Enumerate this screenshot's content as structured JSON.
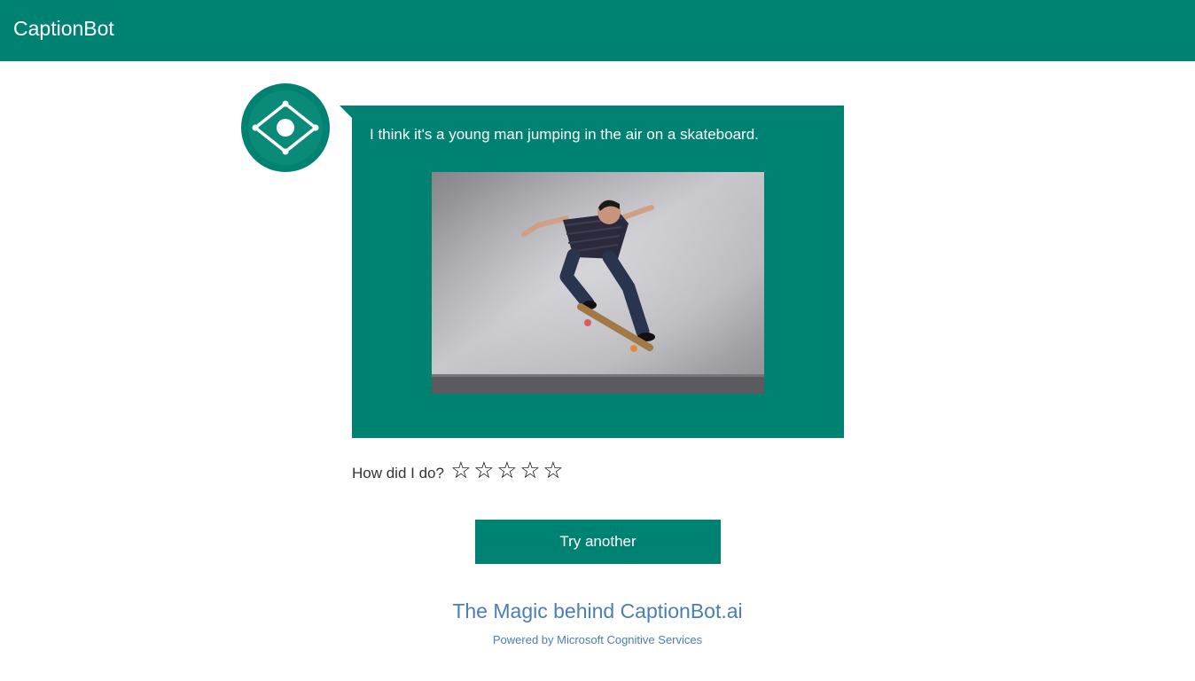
{
  "header": {
    "brand": "CaptionBot"
  },
  "result": {
    "caption": "I think it's a young man jumping in the air on a skateboard.",
    "image_alt": "young man jumping on a skateboard against a concrete wall"
  },
  "rating": {
    "prompt": "How did I do?",
    "stars": [
      "☆",
      "☆",
      "☆",
      "☆",
      "☆"
    ],
    "selected": 0,
    "max": 5
  },
  "actions": {
    "try_another_label": "Try another"
  },
  "footer": {
    "magic_link": "The Magic behind CaptionBot.ai",
    "powered_by": "Powered by Microsoft Cognitive Services"
  },
  "colors": {
    "brand": "#008272",
    "link": "#4a7eb5",
    "text": "#333333"
  },
  "icons": {
    "avatar": "eye-diamond-icon"
  }
}
